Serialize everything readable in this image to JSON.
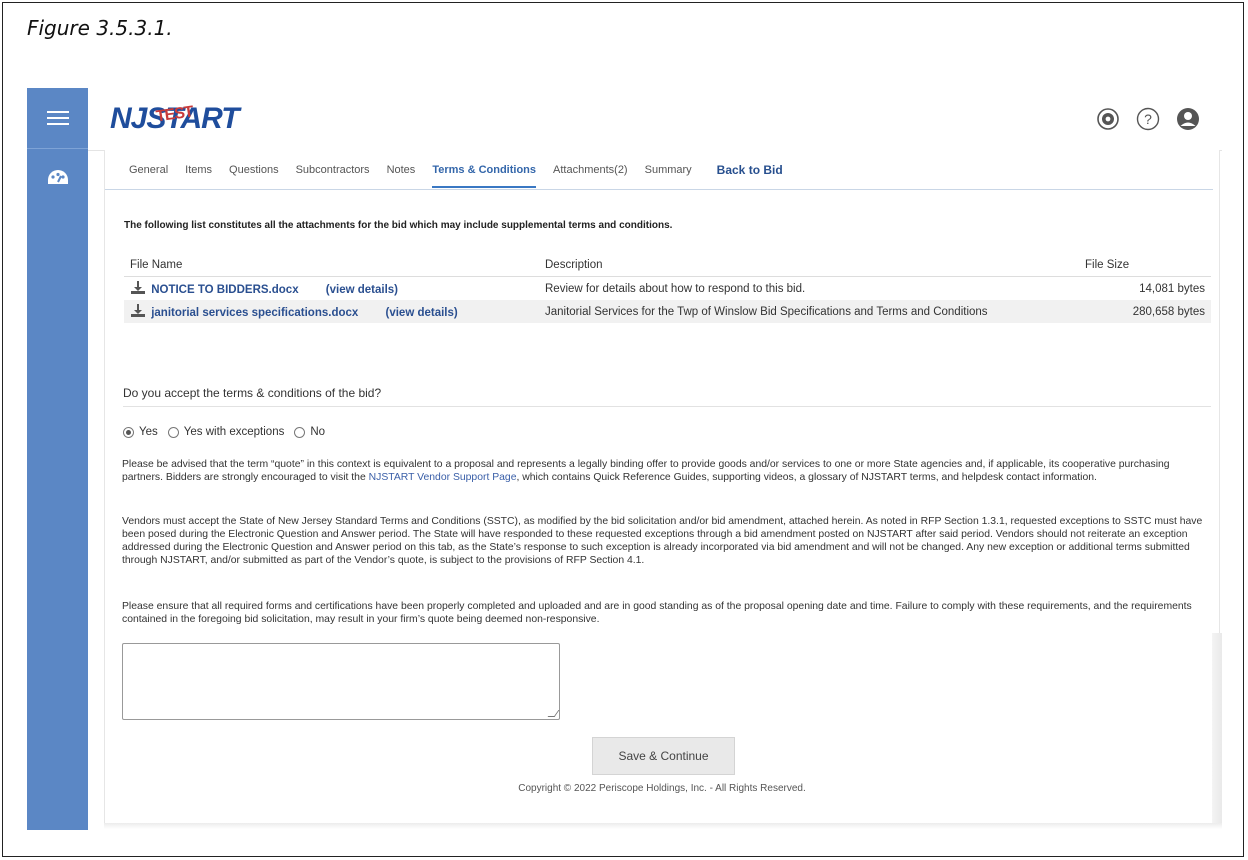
{
  "caption": "Figure 3.5.3.1.",
  "header": {
    "logo_left": "NJ",
    "logo_right": "START",
    "logo_overlay": "TEST"
  },
  "tabs": [
    {
      "label": "General"
    },
    {
      "label": "Items"
    },
    {
      "label": "Questions"
    },
    {
      "label": "Subcontractors"
    },
    {
      "label": "Notes"
    },
    {
      "label": "Terms & Conditions",
      "active": true
    },
    {
      "label": "Attachments(2)"
    },
    {
      "label": "Summary"
    },
    {
      "label": "Back to Bid"
    }
  ],
  "attachments": {
    "intro": "The following list constitutes all the attachments for the bid which may include supplemental terms and conditions.",
    "columns": [
      "File Name",
      "Description",
      "File Size"
    ],
    "rows": [
      {
        "file": "NOTICE TO BIDDERS.docx",
        "details": "(view details)",
        "description": "Review for details about how to respond to this bid.",
        "size": "14,081 bytes"
      },
      {
        "file": "janitorial services specifications.docx",
        "details": "(view details)",
        "description": "Janitorial Services for the Twp of Winslow Bid Specifications and Terms and Conditions",
        "size": "280,658 bytes"
      }
    ]
  },
  "terms": {
    "question": "Do you accept the terms & conditions of the bid?",
    "options": [
      "Yes",
      "Yes with exceptions",
      "No"
    ],
    "selected": "Yes",
    "para1_a": "Please be advised that the term “quote” in this context is equivalent to a proposal and represents a legally binding offer to provide goods and/or services to one or more State agencies and, if applicable, its cooperative purchasing partners. Bidders are strongly encouraged to visit the ",
    "para1_link": "NJSTART Vendor Support Page",
    "para1_b": ", which contains Quick Reference Guides, supporting videos, a glossary of NJSTART terms, and helpdesk contact information.",
    "para2": "Vendors must accept the State of New Jersey Standard Terms and Conditions (SSTC), as modified by the bid solicitation and/or bid amendment, attached herein. As noted in RFP Section 1.3.1, requested exceptions to SSTC must have been posed during the Electronic Question and Answer period. The State will have responded to these requested exceptions through a bid amendment posted on NJSTART after said period. Vendors should not reiterate an exception addressed during the Electronic Question and Answer period on this tab, as the State’s response to such exception is already incorporated via bid amendment and will not be changed. Any new exception or additional terms submitted through NJSTART, and/or submitted as part of the Vendor’s quote, is subject to the provisions of RFP Section 4.1.",
    "para3": "Please ensure that all required forms and certifications have been properly completed and uploaded and are in good standing as of the proposal opening date and time. Failure to comply with these requirements, and the requirements contained in the foregoing bid solicitation, may result in your firm’s quote being deemed non-responsive.",
    "comment_value": ""
  },
  "actions": {
    "save_label": "Save & Continue"
  },
  "footer": {
    "copyright": "Copyright © 2022 Periscope Holdings, Inc. - All Rights Reserved."
  },
  "colors": {
    "sidebar": "#5b87c5",
    "link": "#2a4f90",
    "active_tab": "#3366aa"
  }
}
